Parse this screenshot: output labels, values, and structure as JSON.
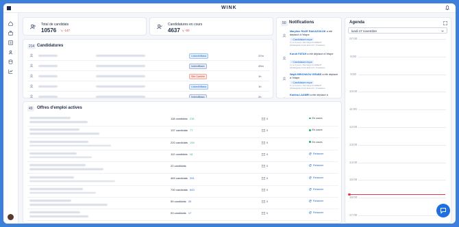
{
  "app": {
    "brand": "WINK"
  },
  "stats": {
    "total": {
      "label": "Total de candidats",
      "value": "10576",
      "delta": "-147"
    },
    "en_cours": {
      "label": "Candidatures en cours",
      "value": "4637",
      "delta": "-50"
    }
  },
  "candidatures": {
    "count": "214",
    "title": "Candidatures",
    "rows": [
      {
        "source": "LinkedInBasic",
        "source_type": "li",
        "time": "37m"
      },
      {
        "source": "IndeedBasic",
        "source_type": "ind",
        "time": "49m"
      },
      {
        "source": "Site Carrière",
        "source_type": "site",
        "time": "1h"
      },
      {
        "source": "LinkedInBasic",
        "source_type": "li",
        "time": "1h"
      },
      {
        "source": "IndeedBasic",
        "source_type": "ind",
        "time": "2h"
      }
    ]
  },
  "offres": {
    "count": "49",
    "title": "Offres d'emploi actives",
    "rows": [
      {
        "cands": "118 candidats",
        "delta": "215",
        "delta_color": "green",
        "msgs": "0",
        "status": "En cours"
      },
      {
        "cands": "137 candidats",
        "delta": "77",
        "delta_color": "green",
        "msgs": "0",
        "status": "En cours"
      },
      {
        "cands": "220 candidats",
        "delta": "194",
        "delta_color": "green",
        "msgs": "0",
        "status": "En cours"
      },
      {
        "cands": "112 candidats",
        "delta": "18",
        "delta_color": "green",
        "msgs": "0",
        "status": "Relancer"
      },
      {
        "cands": "22 candidats",
        "delta": "",
        "delta_color": "green",
        "msgs": "0",
        "status": "Relancer"
      },
      {
        "cands": "469 candidats",
        "delta": "291",
        "delta_color": "blue",
        "msgs": "0",
        "status": "Relancer"
      },
      {
        "cands": "730 candidats",
        "delta": "643",
        "delta_color": "blue",
        "msgs": "0",
        "status": "Relancer"
      },
      {
        "cands": "59 candidats",
        "delta": "20",
        "delta_color": "blue",
        "msgs": "0",
        "status": "Relancer"
      },
      {
        "cands": "53 candidats",
        "delta": "17",
        "delta_color": "blue",
        "msgs": "0",
        "status": "Relancer"
      }
    ]
  },
  "notifications": {
    "count": "50",
    "title": "Notifications",
    "items": [
      {
        "name": "Maryline RAZE RAKAZOKOK",
        "action": "a été déplacé à l'étape",
        "tag": "Candidature reçue",
        "meta1": "Il y a 2 jours • Par Hugo FLORENT",
        "meta2": "(Stratégiste) Front End UX • Freelance"
      },
      {
        "name": "Kuruh FATAH",
        "action": "a été déplacé à l'étape",
        "tag": "Candidature reçue",
        "meta1": "Il y a 2 jours • Par Hugo FLORENT",
        "meta2": "(Stratégiste) Front End UX • Freelance"
      },
      {
        "name": "Wajih BRICHAOU GRABS",
        "action": "a été déplacé à l'étape",
        "tag": "Candidature reçue",
        "meta1": "Il y a 2 jours • Par Hugo FLORENT",
        "meta2": "(Stratégiste) Front End UX • Freelance"
      },
      {
        "name": "Karima LAAMRI",
        "action": "a été déplacé à",
        "tag": "",
        "meta1": "",
        "meta2": ""
      }
    ]
  },
  "agenda": {
    "title": "Agenda",
    "date_select": "lundi 17 novembre",
    "hours": [
      "07:00",
      "8:00",
      "9:00",
      "10:00",
      "11:00",
      "12:00",
      "13:00",
      "14:00",
      "15:00",
      "16:00",
      "17:00"
    ]
  },
  "colors": {
    "accent": "#1f6fe0",
    "background": "#3d7fd9",
    "negative": "#e0364a",
    "positive": "#2cb36b"
  }
}
